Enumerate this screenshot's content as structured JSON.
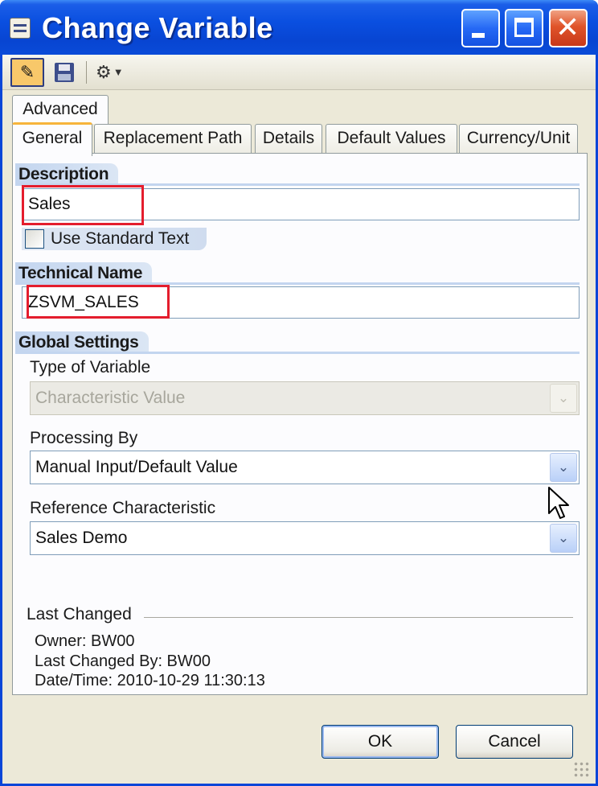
{
  "window": {
    "title": "Change Variable"
  },
  "toolbar": {
    "items": [
      {
        "icon": "edit-pen-icon",
        "active": true
      },
      {
        "icon": "save-disk-icon"
      },
      {
        "icon": "tools-icon",
        "dropdown": true
      }
    ]
  },
  "tabs": {
    "row1": [
      "Advanced"
    ],
    "row2": [
      "General",
      "Replacement Path",
      "Details",
      "Default Values",
      "Currency/Unit"
    ],
    "selected": "General"
  },
  "description": {
    "heading": "Description",
    "value": "Sales",
    "use_standard_text_label": "Use Standard Text",
    "use_standard_text_checked": false
  },
  "technical": {
    "heading": "Technical Name",
    "value": "ZSVM_SALES"
  },
  "global_settings": {
    "heading": "Global Settings",
    "type_label": "Type of Variable",
    "type_value": "Characteristic Value",
    "processing_label": "Processing By",
    "processing_value": "Manual Input/Default Value",
    "reference_label": "Reference Characteristic",
    "reference_value": "Sales Demo"
  },
  "last_changed": {
    "heading": "Last Changed",
    "owner": "Owner: BW00",
    "changed_by": "Last Changed By: BW00",
    "datetime": "Date/Time: 2010-10-29 11:30:13"
  },
  "buttons": {
    "ok": "OK",
    "cancel": "Cancel"
  },
  "colors": {
    "titlebar": "#0a4fe0",
    "highlight": "#e41d2d",
    "section_band": "#c3d5ef"
  }
}
